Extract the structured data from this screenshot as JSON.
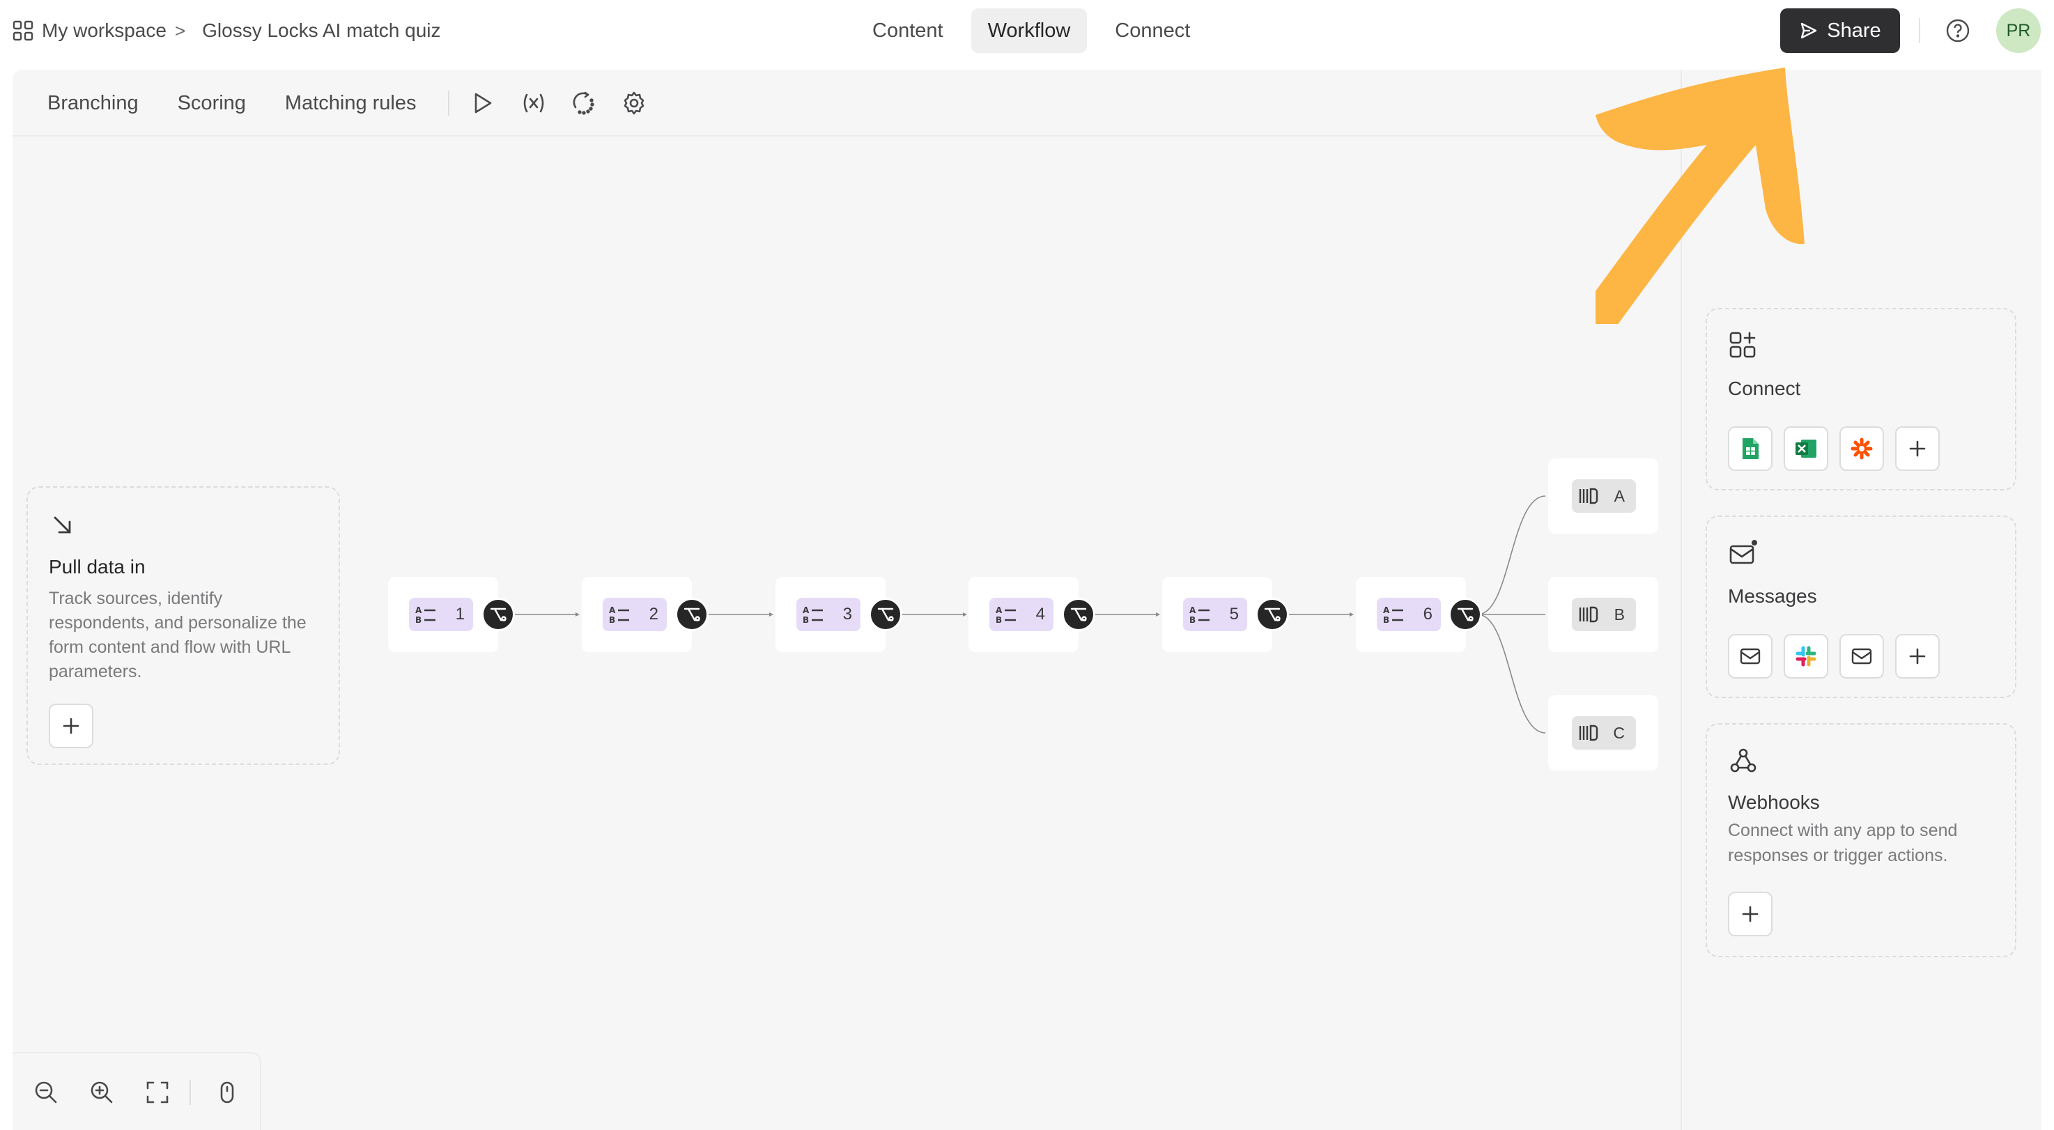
{
  "header": {
    "workspace_label": "My workspace",
    "separator": ">",
    "form_title": "Glossy Locks AI match quiz",
    "nav_tabs": [
      {
        "label": "Content",
        "active": false
      },
      {
        "label": "Workflow",
        "active": true
      },
      {
        "label": "Connect",
        "active": false
      }
    ],
    "share_label": "Share",
    "avatar_initials": "PR"
  },
  "toolbar": {
    "tabs": [
      "Branching",
      "Scoring",
      "Matching rules"
    ],
    "icons": [
      "play-icon",
      "variable-icon",
      "logic-map-icon",
      "settings-icon"
    ]
  },
  "pull_data": {
    "title": "Pull data in",
    "description": "Track sources, identify respondents, and personalize the form content and flow with URL parameters."
  },
  "flow": {
    "questions": [
      "1",
      "2",
      "3",
      "4",
      "5",
      "6"
    ],
    "endings": [
      "A",
      "B",
      "C"
    ]
  },
  "zoom_controls": [
    "zoom-out-icon",
    "zoom-in-icon",
    "fit-view-icon",
    "mouse-mode-icon"
  ],
  "right_panel": {
    "connect": {
      "title": "Connect",
      "apps": [
        "google-sheets-icon",
        "excel-icon",
        "zapier-icon"
      ]
    },
    "messages": {
      "title": "Messages",
      "apps": [
        "email-icon",
        "slack-icon",
        "email-icon"
      ]
    },
    "webhooks": {
      "title": "Webhooks",
      "description": "Connect with any app to send responses or trigger actions."
    }
  },
  "colors": {
    "accent_arrow": "#FDB544",
    "share_bg": "#2F2F31",
    "question_pill": "#E6DCF8",
    "avatar_bg": "#CDE8C2"
  }
}
